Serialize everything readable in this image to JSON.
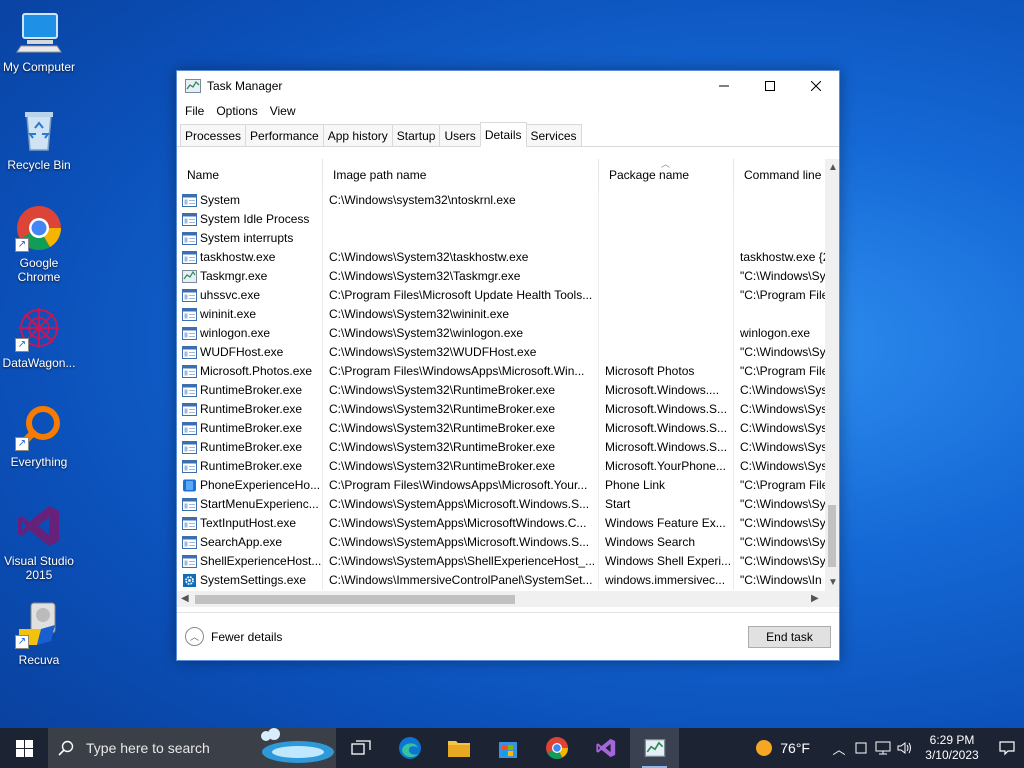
{
  "desktop": {
    "icons": [
      {
        "label": "My Computer",
        "icon": "computer-icon"
      },
      {
        "label": "Recycle Bin",
        "icon": "recycle-bin-icon"
      },
      {
        "label": "Google Chrome",
        "icon": "chrome-icon"
      },
      {
        "label": "DataWagon...",
        "icon": "datawagon-icon"
      },
      {
        "label": "Everything",
        "icon": "everything-icon"
      },
      {
        "label": "Visual Studio 2015",
        "icon": "visual-studio-icon"
      },
      {
        "label": "Recuva",
        "icon": "recuva-icon"
      }
    ]
  },
  "window": {
    "title": "Task Manager",
    "menu": [
      "File",
      "Options",
      "View"
    ],
    "tabs": [
      "Processes",
      "Performance",
      "App history",
      "Startup",
      "Users",
      "Details",
      "Services"
    ],
    "active_tab": "Details",
    "columns": [
      "Name",
      "Image path name",
      "Package name",
      "Command line"
    ],
    "rows": [
      {
        "name": "System",
        "path": "C:\\Windows\\system32\\ntoskrnl.exe",
        "pkg": "",
        "cmd": "",
        "icon": "window-app-icon"
      },
      {
        "name": "System Idle Process",
        "path": "",
        "pkg": "",
        "cmd": "",
        "icon": "window-app-icon"
      },
      {
        "name": "System interrupts",
        "path": "",
        "pkg": "",
        "cmd": "",
        "icon": "window-app-icon"
      },
      {
        "name": "taskhostw.exe",
        "path": "C:\\Windows\\System32\\taskhostw.exe",
        "pkg": "",
        "cmd": "taskhostw.exe {2",
        "icon": "window-app-icon"
      },
      {
        "name": "Taskmgr.exe",
        "path": "C:\\Windows\\System32\\Taskmgr.exe",
        "pkg": "",
        "cmd": "\"C:\\Windows\\Sy",
        "icon": "task-manager-icon"
      },
      {
        "name": "uhssvc.exe",
        "path": "C:\\Program Files\\Microsoft Update Health Tools...",
        "pkg": "",
        "cmd": "\"C:\\Program File",
        "icon": "window-app-icon"
      },
      {
        "name": "wininit.exe",
        "path": "C:\\Windows\\System32\\wininit.exe",
        "pkg": "",
        "cmd": "",
        "icon": "window-app-icon"
      },
      {
        "name": "winlogon.exe",
        "path": "C:\\Windows\\System32\\winlogon.exe",
        "pkg": "",
        "cmd": "winlogon.exe",
        "icon": "window-app-icon"
      },
      {
        "name": "WUDFHost.exe",
        "path": "C:\\Windows\\System32\\WUDFHost.exe",
        "pkg": "",
        "cmd": "\"C:\\Windows\\Sy",
        "icon": "window-app-icon"
      },
      {
        "name": "Microsoft.Photos.exe",
        "path": "C:\\Program Files\\WindowsApps\\Microsoft.Win...",
        "pkg": "Microsoft Photos",
        "cmd": "\"C:\\Program File",
        "icon": "window-app-icon"
      },
      {
        "name": "RuntimeBroker.exe",
        "path": "C:\\Windows\\System32\\RuntimeBroker.exe",
        "pkg": "Microsoft.Windows....",
        "cmd": "C:\\Windows\\Sys",
        "icon": "window-app-icon"
      },
      {
        "name": "RuntimeBroker.exe",
        "path": "C:\\Windows\\System32\\RuntimeBroker.exe",
        "pkg": "Microsoft.Windows.S...",
        "cmd": "C:\\Windows\\Sys",
        "icon": "window-app-icon"
      },
      {
        "name": "RuntimeBroker.exe",
        "path": "C:\\Windows\\System32\\RuntimeBroker.exe",
        "pkg": "Microsoft.Windows.S...",
        "cmd": "C:\\Windows\\Sys",
        "icon": "window-app-icon"
      },
      {
        "name": "RuntimeBroker.exe",
        "path": "C:\\Windows\\System32\\RuntimeBroker.exe",
        "pkg": "Microsoft.Windows.S...",
        "cmd": "C:\\Windows\\Sys",
        "icon": "window-app-icon"
      },
      {
        "name": "RuntimeBroker.exe",
        "path": "C:\\Windows\\System32\\RuntimeBroker.exe",
        "pkg": "Microsoft.YourPhone...",
        "cmd": "C:\\Windows\\Sys",
        "icon": "window-app-icon"
      },
      {
        "name": "PhoneExperienceHo...",
        "path": "C:\\Program Files\\WindowsApps\\Microsoft.Your...",
        "pkg": "Phone Link",
        "cmd": "\"C:\\Program File",
        "icon": "phone-link-icon"
      },
      {
        "name": "StartMenuExperienc...",
        "path": "C:\\Windows\\SystemApps\\Microsoft.Windows.S...",
        "pkg": "Start",
        "cmd": "\"C:\\Windows\\Sy",
        "icon": "window-app-icon"
      },
      {
        "name": "TextInputHost.exe",
        "path": "C:\\Windows\\SystemApps\\MicrosoftWindows.C...",
        "pkg": "Windows Feature Ex...",
        "cmd": "\"C:\\Windows\\Sy",
        "icon": "window-app-icon"
      },
      {
        "name": "SearchApp.exe",
        "path": "C:\\Windows\\SystemApps\\Microsoft.Windows.S...",
        "pkg": "Windows Search",
        "cmd": "\"C:\\Windows\\Sy",
        "icon": "window-app-icon"
      },
      {
        "name": "ShellExperienceHost....",
        "path": "C:\\Windows\\SystemApps\\ShellExperienceHost_...",
        "pkg": "Windows Shell Experi...",
        "cmd": "\"C:\\Windows\\Sy",
        "icon": "window-app-icon"
      },
      {
        "name": "SystemSettings.exe",
        "path": "C:\\Windows\\ImmersiveControlPanel\\SystemSet...",
        "pkg": "windows.immersivec...",
        "cmd": "\"C:\\Windows\\In",
        "icon": "settings-gear-icon"
      }
    ],
    "footer": {
      "fewer_details": "Fewer details",
      "end_task": "End task"
    }
  },
  "taskbar": {
    "search_placeholder": "Type here to search",
    "temperature": "76°F",
    "time": "6:29 PM",
    "date": "3/10/2023"
  },
  "colors": {
    "accent": "#0b4fb8",
    "taskbar": "#1c2332",
    "window_border": "#5c8bd6"
  }
}
